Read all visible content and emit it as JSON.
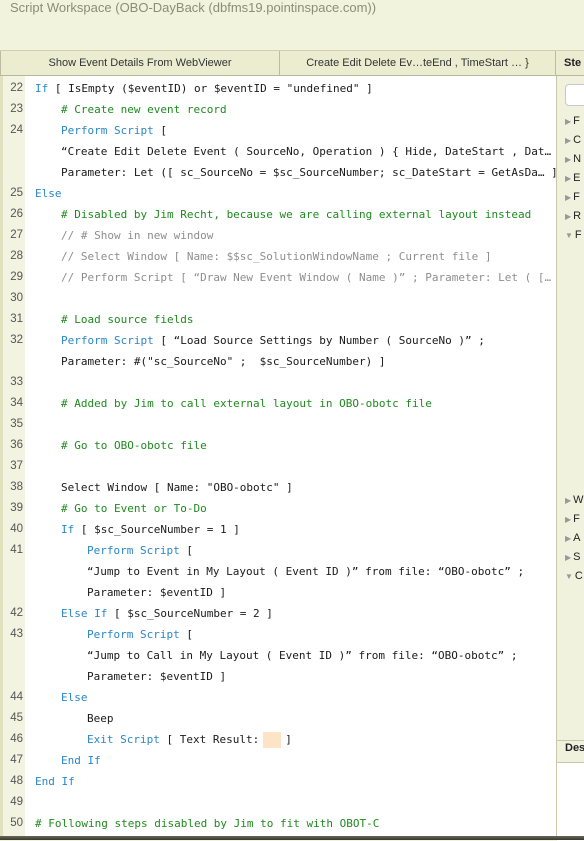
{
  "window": {
    "title": "Script Workspace (OBO-DayBack (dbfms19.pointinspace.com))"
  },
  "tabs": [
    {
      "label": "Show Event Details From WebViewer"
    },
    {
      "label": "Create Edit Delete Ev…teEnd , TimeStart … }"
    }
  ],
  "steps_panel": {
    "header": "Ste",
    "search_placeholder": "",
    "categories_top": [
      {
        "label": "F",
        "expanded": false
      },
      {
        "label": "C",
        "expanded": false
      },
      {
        "label": "N",
        "expanded": false
      },
      {
        "label": "E",
        "expanded": false
      },
      {
        "label": "F",
        "expanded": false
      },
      {
        "label": "R",
        "expanded": false
      },
      {
        "label": "F",
        "expanded": true
      }
    ],
    "categories_bottom": [
      {
        "label": "W",
        "expanded": false
      },
      {
        "label": "F",
        "expanded": false
      },
      {
        "label": "A",
        "expanded": false
      },
      {
        "label": "S",
        "expanded": false
      },
      {
        "label": "C",
        "expanded": true
      }
    ],
    "description_label": "Des"
  },
  "script_lines": [
    {
      "num": "22",
      "indent": 0,
      "parts": [
        {
          "t": "If",
          "c": "kw"
        },
        {
          "t": " [ IsEmpty ($eventID) or $eventID = \"undefined\" ]",
          "c": ""
        }
      ]
    },
    {
      "num": "23",
      "indent": 1,
      "parts": [
        {
          "t": "# Create new event record",
          "c": "cm"
        }
      ]
    },
    {
      "num": "24",
      "indent": 1,
      "parts": [
        {
          "t": "Perform Script",
          "c": "kw"
        },
        {
          "t": " [",
          "c": ""
        }
      ]
    },
    {
      "num": "",
      "indent": 1,
      "parts": [
        {
          "t": "“Create Edit Delete Event ( SourceNo, Operation ) { Hide, DateStart , Dat…",
          "c": ""
        }
      ]
    },
    {
      "num": "",
      "indent": 1,
      "parts": [
        {
          "t": "Parameter: Let ([ sc_SourceNo = $sc_SourceNumber; sc_DateStart = GetAsDa… ]",
          "c": ""
        }
      ]
    },
    {
      "num": "25",
      "indent": 0,
      "parts": [
        {
          "t": "Else",
          "c": "kw"
        }
      ]
    },
    {
      "num": "26",
      "indent": 1,
      "parts": [
        {
          "t": "# Disabled by Jim Recht, because we are calling external layout instead",
          "c": "cm"
        }
      ]
    },
    {
      "num": "27",
      "indent": 1,
      "parts": [
        {
          "t": "// # Show in new window",
          "c": "dis"
        }
      ]
    },
    {
      "num": "28",
      "indent": 1,
      "parts": [
        {
          "t": "// Select Window [ Name: $$sc_SolutionWindowName ; Current file ]",
          "c": "dis"
        }
      ]
    },
    {
      "num": "29",
      "indent": 1,
      "parts": [
        {
          "t": "// Perform Script [ “Draw New Event Window ( Name )” ; Parameter: Let ( [… ]",
          "c": "dis"
        }
      ]
    },
    {
      "num": "30",
      "indent": 0,
      "parts": []
    },
    {
      "num": "31",
      "indent": 1,
      "parts": [
        {
          "t": "# Load source fields",
          "c": "cm"
        }
      ]
    },
    {
      "num": "32",
      "indent": 1,
      "parts": [
        {
          "t": "Perform Script",
          "c": "kw"
        },
        {
          "t": " [ “Load Source Settings by Number ( SourceNo )” ;",
          "c": ""
        }
      ]
    },
    {
      "num": "",
      "indent": 1,
      "parts": [
        {
          "t": "Parameter: #(\"sc_SourceNo\" ;  $sc_SourceNumber) ]",
          "c": ""
        }
      ]
    },
    {
      "num": "33",
      "indent": 0,
      "parts": []
    },
    {
      "num": "34",
      "indent": 1,
      "parts": [
        {
          "t": "# Added by Jim to call external layout in OBO-obotc file",
          "c": "cm"
        }
      ]
    },
    {
      "num": "35",
      "indent": 0,
      "parts": []
    },
    {
      "num": "36",
      "indent": 1,
      "parts": [
        {
          "t": "# Go to OBO-obotc file",
          "c": "cm"
        }
      ]
    },
    {
      "num": "37",
      "indent": 0,
      "parts": []
    },
    {
      "num": "38",
      "indent": 1,
      "parts": [
        {
          "t": "Select Window [ Name: \"OBO-obotc\" ]",
          "c": ""
        }
      ]
    },
    {
      "num": "39",
      "indent": 1,
      "parts": [
        {
          "t": "# Go to Event or To-Do",
          "c": "cm"
        }
      ]
    },
    {
      "num": "40",
      "indent": 1,
      "parts": [
        {
          "t": "If",
          "c": "kw"
        },
        {
          "t": " [ $sc_SourceNumber = 1 ]",
          "c": ""
        }
      ]
    },
    {
      "num": "41",
      "indent": 2,
      "parts": [
        {
          "t": "Perform Script",
          "c": "kw"
        },
        {
          "t": " [",
          "c": ""
        }
      ]
    },
    {
      "num": "",
      "indent": 2,
      "parts": [
        {
          "t": "“Jump to Event in My Layout ( Event ID )” from file: “OBO-obotc” ;",
          "c": ""
        }
      ]
    },
    {
      "num": "",
      "indent": 2,
      "parts": [
        {
          "t": "Parameter: $eventID ]",
          "c": ""
        }
      ]
    },
    {
      "num": "42",
      "indent": 1,
      "parts": [
        {
          "t": "Else If",
          "c": "kw"
        },
        {
          "t": " [ $sc_SourceNumber = 2 ]",
          "c": ""
        }
      ]
    },
    {
      "num": "43",
      "indent": 2,
      "parts": [
        {
          "t": "Perform Script",
          "c": "kw"
        },
        {
          "t": " [",
          "c": ""
        }
      ]
    },
    {
      "num": "",
      "indent": 2,
      "parts": [
        {
          "t": "“Jump to Call in My Layout ( Event ID )” from file: “OBO-obotc” ;",
          "c": ""
        }
      ]
    },
    {
      "num": "",
      "indent": 2,
      "parts": [
        {
          "t": "Parameter: $eventID ]",
          "c": ""
        }
      ]
    },
    {
      "num": "44",
      "indent": 1,
      "parts": [
        {
          "t": "Else",
          "c": "kw"
        }
      ]
    },
    {
      "num": "45",
      "indent": 2,
      "parts": [
        {
          "t": "Beep",
          "c": ""
        }
      ]
    },
    {
      "num": "46",
      "indent": 2,
      "parts": [
        {
          "t": "Exit Script",
          "c": "kw"
        },
        {
          "t": " [ Text Result:",
          "c": ""
        },
        {
          "t": "",
          "c": "pad"
        },
        {
          "t": "]",
          "c": ""
        }
      ]
    },
    {
      "num": "47",
      "indent": 1,
      "parts": [
        {
          "t": "End If",
          "c": "kw"
        }
      ]
    },
    {
      "num": "48",
      "indent": 0,
      "parts": [
        {
          "t": "End If",
          "c": "kw"
        }
      ]
    },
    {
      "num": "49",
      "indent": 0,
      "parts": []
    },
    {
      "num": "50",
      "indent": 0,
      "parts": [
        {
          "t": "# Following steps disabled by Jim to fit with OBOT-C",
          "c": "cm"
        }
      ]
    }
  ]
}
